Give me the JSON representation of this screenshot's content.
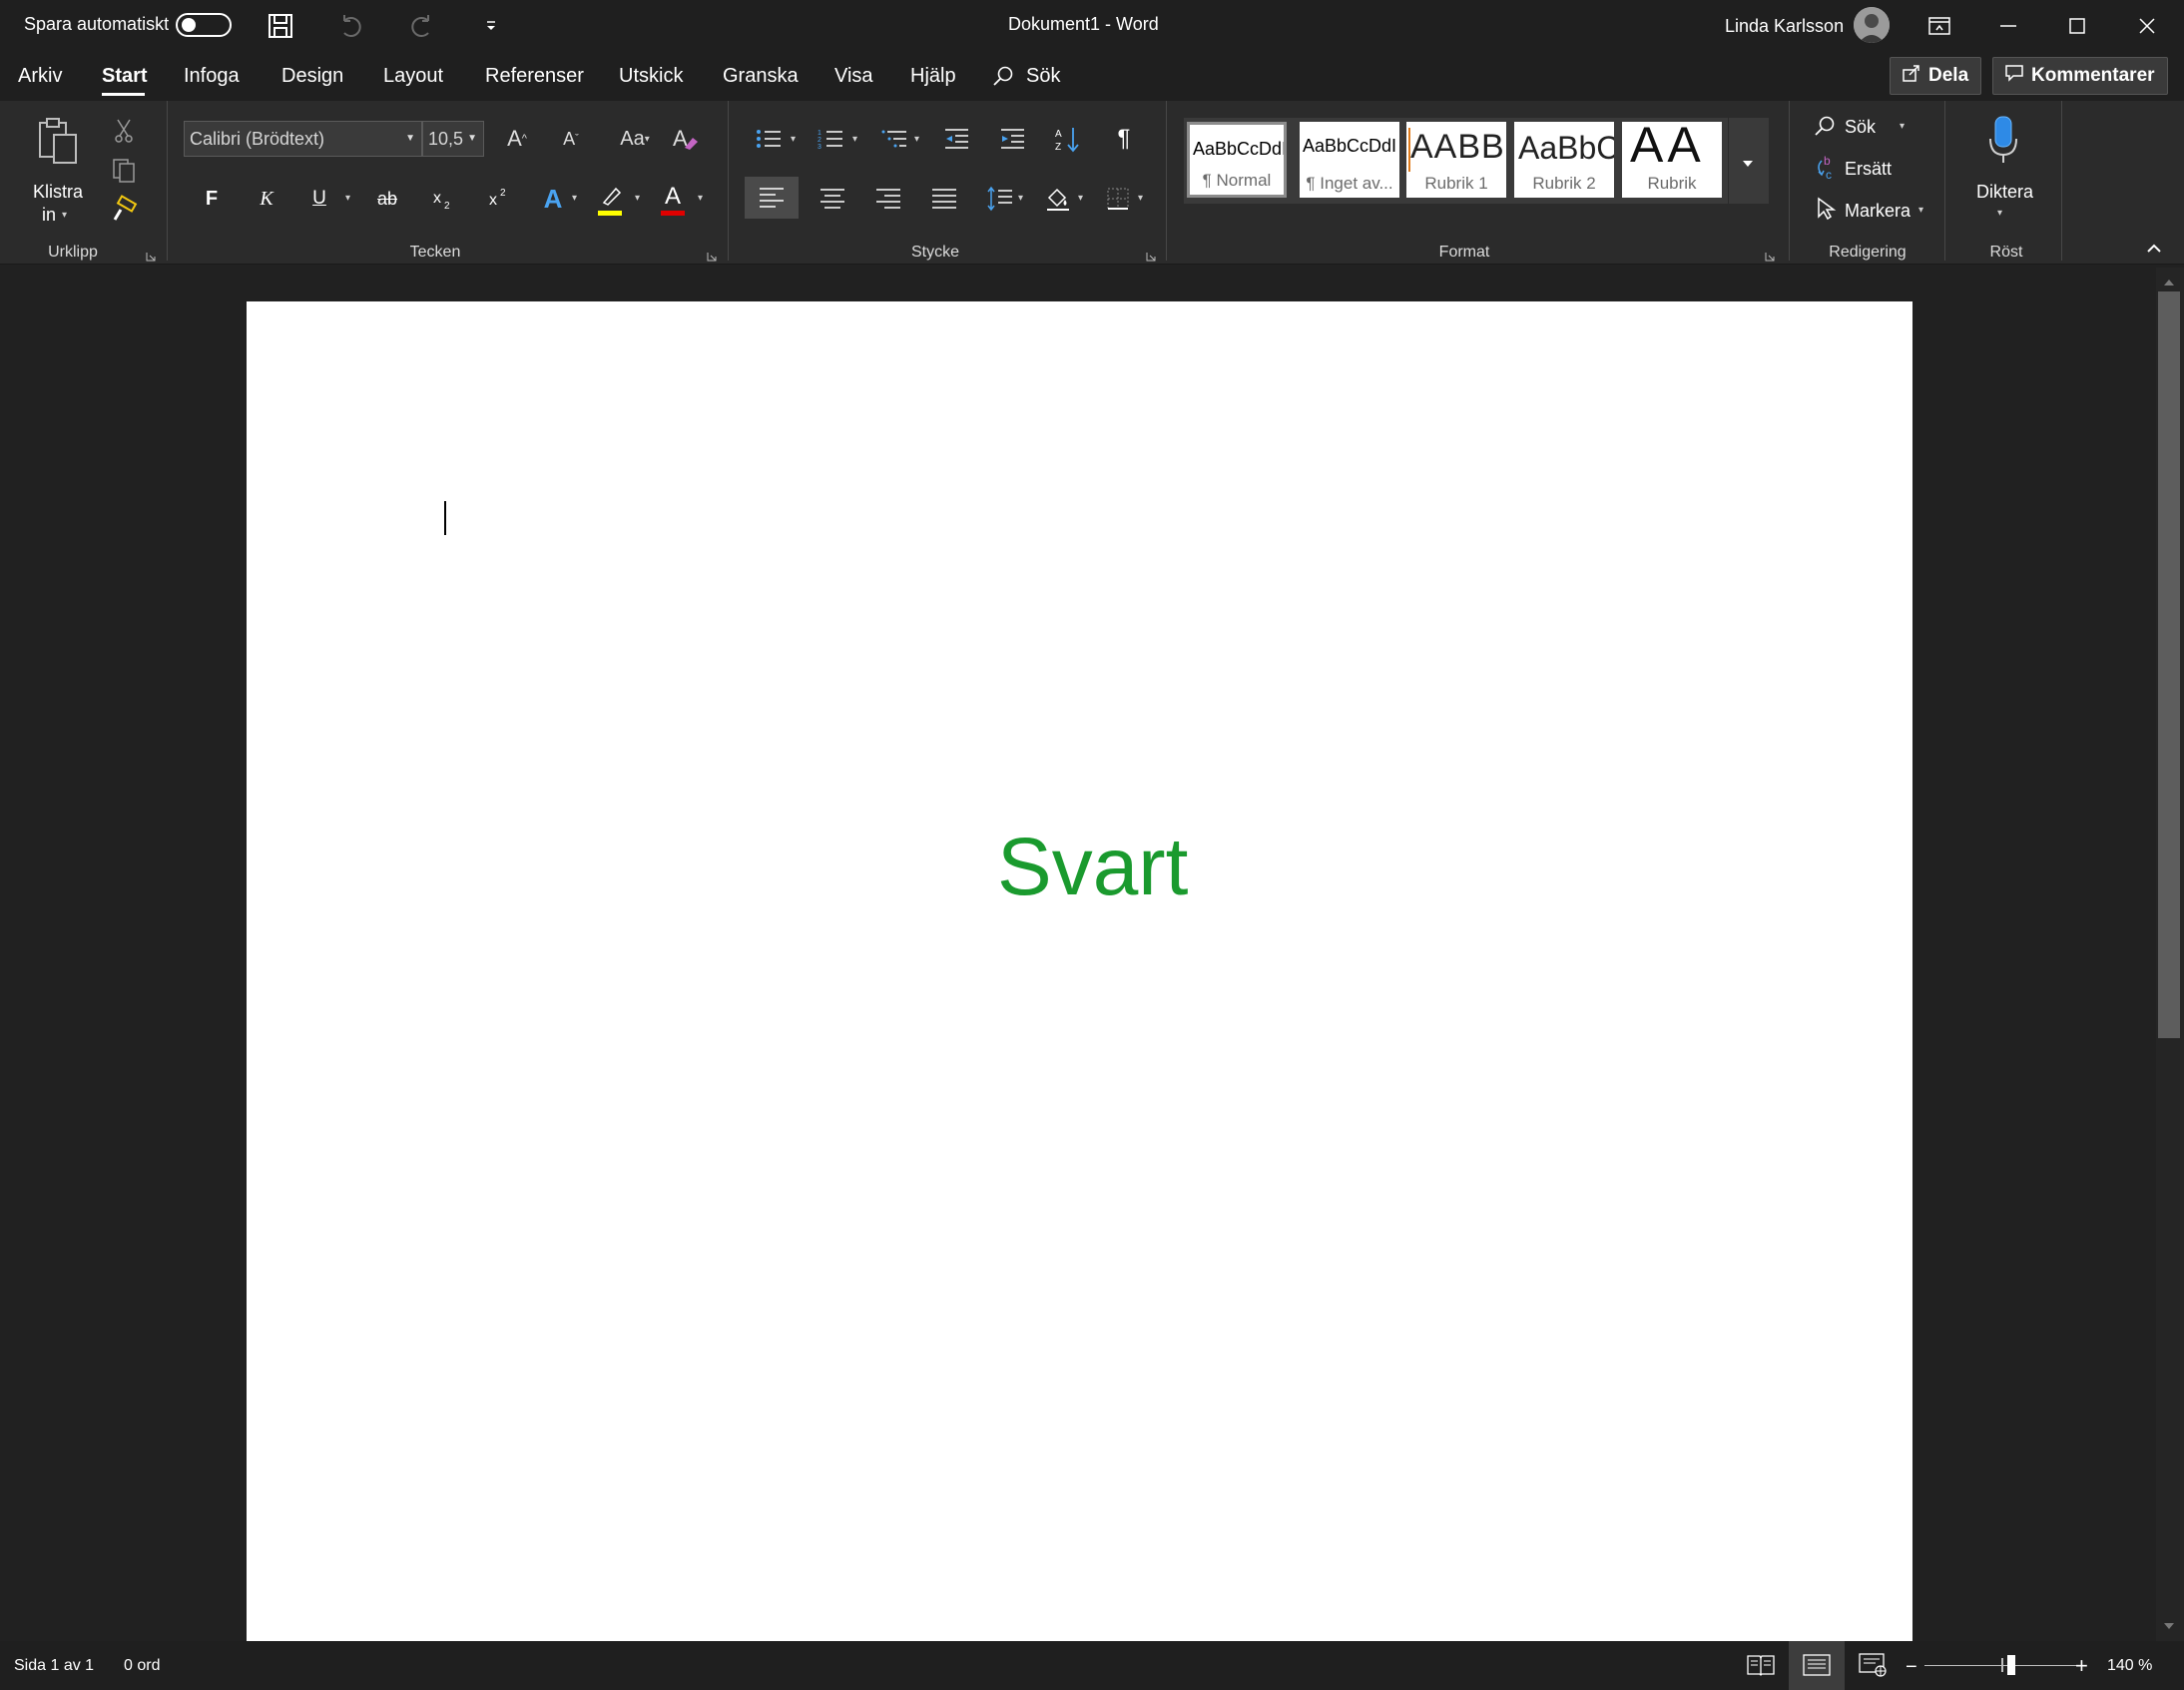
{
  "titlebar": {
    "autosave_label": "Spara automatiskt",
    "autosave_on": false,
    "doc_title": "Dokument1  -  Word",
    "user_name": "Linda Karlsson"
  },
  "tabs": [
    {
      "label": "Arkiv"
    },
    {
      "label": "Start",
      "active": true
    },
    {
      "label": "Infoga"
    },
    {
      "label": "Design"
    },
    {
      "label": "Layout"
    },
    {
      "label": "Referenser"
    },
    {
      "label": "Utskick"
    },
    {
      "label": "Granska"
    },
    {
      "label": "Visa"
    },
    {
      "label": "Hjälp"
    },
    {
      "label": "Sök"
    }
  ],
  "header_buttons": {
    "share": "Dela",
    "comments": "Kommentarer"
  },
  "ribbon": {
    "clipboard": {
      "label": "Urklipp",
      "paste_line1": "Klistra",
      "paste_line2": "in"
    },
    "font": {
      "label": "Tecken",
      "font_name": "Calibri (Brödtext)",
      "font_size": "10,5",
      "bold": "F",
      "italic": "K",
      "underline": "U",
      "strike": "ab",
      "change_case": "Aa",
      "grow": "A",
      "shrink": "A",
      "effects": "A",
      "font_color": "A",
      "highlight_color": "#ffff00",
      "font_color_bar": "#e00000"
    },
    "paragraph": {
      "label": "Stycke",
      "pilcrow": "¶"
    },
    "styles": {
      "label": "Format",
      "items": [
        {
          "sample": "AaBbCcDdI",
          "name": "¶ Normal",
          "selected": true
        },
        {
          "sample": "AaBbCcDdI",
          "name": "¶ Inget av..."
        },
        {
          "sample": "AABBC",
          "name": "Rubrik 1"
        },
        {
          "sample": "AaBbC",
          "name": "Rubrik 2"
        },
        {
          "sample": "AA",
          "name": "Rubrik"
        }
      ]
    },
    "editing": {
      "label": "Redigering",
      "find": "Sök",
      "replace": "Ersätt",
      "select": "Markera"
    },
    "voice": {
      "label": "Röst",
      "dictate": "Diktera"
    }
  },
  "document": {
    "text": "Svart",
    "text_color": "#1a9a2e"
  },
  "statusbar": {
    "page": "Sida 1 av 1",
    "words": "0 ord",
    "zoom": "140 %",
    "zoom_fraction": 0.5
  }
}
